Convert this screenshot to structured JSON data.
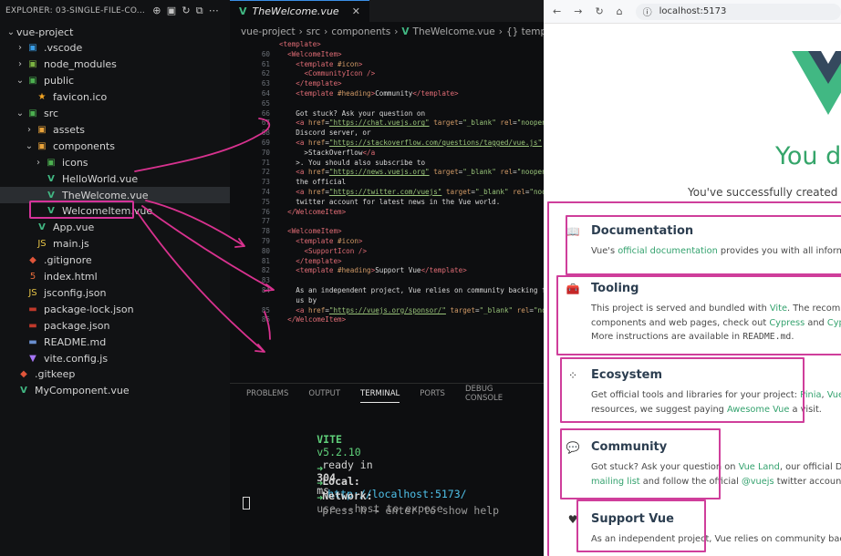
{
  "explorer": {
    "header": "EXPLORER: 03-SINGLE-FILE-CO...",
    "tree": [
      {
        "label": "vue-project",
        "depth": 0,
        "chev": "⌄",
        "icon": "",
        "icolor": "#ccc"
      },
      {
        "label": ".vscode",
        "depth": 1,
        "chev": "›",
        "icon": "▣",
        "icolor": "#3a9ee8"
      },
      {
        "label": "node_modules",
        "depth": 1,
        "chev": "›",
        "icon": "▣",
        "icolor": "#7cb342"
      },
      {
        "label": "public",
        "depth": 1,
        "chev": "⌄",
        "icon": "▣",
        "icolor": "#4caf50"
      },
      {
        "label": "favicon.ico",
        "depth": 2,
        "chev": "",
        "icon": "★",
        "icolor": "#f5a623"
      },
      {
        "label": "src",
        "depth": 1,
        "chev": "⌄",
        "icon": "▣",
        "icolor": "#4caf50"
      },
      {
        "label": "assets",
        "depth": 2,
        "chev": "›",
        "icon": "▣",
        "icolor": "#e8a23a"
      },
      {
        "label": "components",
        "depth": 2,
        "chev": "⌄",
        "icon": "▣",
        "icolor": "#e8a23a"
      },
      {
        "label": "icons",
        "depth": 3,
        "chev": "›",
        "icon": "▣",
        "icolor": "#4caf50"
      },
      {
        "label": "HelloWorld.vue",
        "depth": 3,
        "chev": "",
        "icon": "V",
        "icolor": "#41b883"
      },
      {
        "label": "TheWelcome.vue",
        "depth": 3,
        "chev": "",
        "icon": "V",
        "icolor": "#41b883"
      },
      {
        "label": "WelcomeItem.vue",
        "depth": 3,
        "chev": "",
        "icon": "V",
        "icolor": "#41b883"
      },
      {
        "label": "App.vue",
        "depth": 2,
        "chev": "",
        "icon": "V",
        "icolor": "#41b883"
      },
      {
        "label": "main.js",
        "depth": 2,
        "chev": "",
        "icon": "JS",
        "icolor": "#e8c547"
      },
      {
        "label": ".gitignore",
        "depth": 1,
        "chev": "",
        "icon": "◆",
        "icolor": "#e0553a"
      },
      {
        "label": "index.html",
        "depth": 1,
        "chev": "",
        "icon": "5",
        "icolor": "#e86b3a"
      },
      {
        "label": "jsconfig.json",
        "depth": 1,
        "chev": "",
        "icon": "JS",
        "icolor": "#e8c547"
      },
      {
        "label": "package-lock.json",
        "depth": 1,
        "chev": "",
        "icon": "▬",
        "icolor": "#c0392b"
      },
      {
        "label": "package.json",
        "depth": 1,
        "chev": "",
        "icon": "▬",
        "icolor": "#c0392b"
      },
      {
        "label": "README.md",
        "depth": 1,
        "chev": "",
        "icon": "▬",
        "icolor": "#6a8fcf"
      },
      {
        "label": "vite.config.js",
        "depth": 1,
        "chev": "",
        "icon": "▼",
        "icolor": "#a675f5"
      },
      {
        "label": ".gitkeep",
        "depth": 0,
        "chev": "",
        "icon": "◆",
        "icolor": "#e0553a"
      },
      {
        "label": "MyComponent.vue",
        "depth": 0,
        "chev": "",
        "icon": "V",
        "icolor": "#41b883"
      }
    ]
  },
  "editor": {
    "tab_label": "TheWelcome.vue",
    "breadcrumb": [
      "vue-project",
      "src",
      "components",
      "TheWelcome.vue",
      "{} template"
    ],
    "code_lines": [
      {
        "n": "",
        "html": "<span class=\"tg\">&lt;template&gt;</span>"
      },
      {
        "n": "60",
        "html": "  <span class=\"tg\">&lt;WelcomeItem&gt;</span>"
      },
      {
        "n": "61",
        "html": "    <span class=\"tg\">&lt;template</span> <span class=\"at\">#icon</span><span class=\"tg\">&gt;</span>"
      },
      {
        "n": "62",
        "html": "      <span class=\"tg\">&lt;CommunityIcon /&gt;</span>"
      },
      {
        "n": "63",
        "html": "    <span class=\"tg\">&lt;/template&gt;</span>"
      },
      {
        "n": "64",
        "html": "    <span class=\"tg\">&lt;template</span> <span class=\"at\">#heading</span><span class=\"tg\">&gt;</span>Community<span class=\"tg\">&lt;/template&gt;</span>"
      },
      {
        "n": "65",
        "html": ""
      },
      {
        "n": "66",
        "html": "    Got stuck? Ask your question on"
      },
      {
        "n": "67",
        "html": "    <span class=\"tg\">&lt;a</span> <span class=\"at\">href</span>=<span class=\"lk\">\"https://chat.vuejs.org\"</span> <span class=\"at\">target</span>=<span class=\"st\">\"_blank\"</span> <span class=\"at\">rel</span>=<span class=\"st\">\"noopene</span>"
      },
      {
        "n": "68",
        "html": "    Discord server, or"
      },
      {
        "n": "69",
        "html": "    <span class=\"tg\">&lt;a</span> <span class=\"at\">href</span>=<span class=\"lk\">\"https://stackoverflow.com/questions/tagged/vue.js\"</span> <span class=\"at\">t</span>"
      },
      {
        "n": "70",
        "html": "      &gt;StackOverflow<span class=\"tg\">&lt;/a</span>"
      },
      {
        "n": "71",
        "html": "    &gt;. You should also subscribe to"
      },
      {
        "n": "72",
        "html": "    <span class=\"tg\">&lt;a</span> <span class=\"at\">href</span>=<span class=\"lk\">\"https://news.vuejs.org\"</span> <span class=\"at\">target</span>=<span class=\"st\">\"_blank\"</span> <span class=\"at\">rel</span>=<span class=\"st\">\"noopene</span>"
      },
      {
        "n": "73",
        "html": "    the official"
      },
      {
        "n": "74",
        "html": "    <span class=\"tg\">&lt;a</span> <span class=\"at\">href</span>=<span class=\"lk\">\"https://twitter.com/vuejs\"</span> <span class=\"at\">target</span>=<span class=\"st\">\"_blank\"</span> <span class=\"at\">rel</span>=<span class=\"st\">\"noop</span>"
      },
      {
        "n": "75",
        "html": "    twitter account for latest news in the Vue world."
      },
      {
        "n": "76",
        "html": "  <span class=\"tg\">&lt;/WelcomeItem&gt;</span>"
      },
      {
        "n": "77",
        "html": ""
      },
      {
        "n": "78",
        "html": "  <span class=\"tg\">&lt;WelcomeItem&gt;</span>"
      },
      {
        "n": "79",
        "html": "    <span class=\"tg\">&lt;template</span> <span class=\"at\">#icon</span><span class=\"tg\">&gt;</span>"
      },
      {
        "n": "80",
        "html": "      <span class=\"tg\">&lt;SupportIcon /&gt;</span>"
      },
      {
        "n": "81",
        "html": "    <span class=\"tg\">&lt;/template&gt;</span>"
      },
      {
        "n": "82",
        "html": "    <span class=\"tg\">&lt;template</span> <span class=\"at\">#heading</span><span class=\"tg\">&gt;</span>Support Vue<span class=\"tg\">&lt;/template&gt;</span>"
      },
      {
        "n": "83",
        "html": ""
      },
      {
        "n": "84",
        "html": "    As an independent project, Vue relies on community backing fo"
      },
      {
        "n": "",
        "html": "    us by"
      },
      {
        "n": "85",
        "html": "    <span class=\"tg\">&lt;a</span> <span class=\"at\">href</span>=<span class=\"lk\">\"https://vuejs.org/sponsor/\"</span> <span class=\"at\">target</span>=<span class=\"st\">\"_blank\"</span> <span class=\"at\">rel</span>=<span class=\"st\">\"noo</span>"
      },
      {
        "n": "86",
        "html": "  <span class=\"tg\">&lt;/WelcomeItem&gt;</span>"
      }
    ],
    "panel_tabs": [
      "PROBLEMS",
      "OUTPUT",
      "TERMINAL",
      "PORTS",
      "DEBUG CONSOLE"
    ],
    "panel_active": "TERMINAL",
    "terminal": {
      "vite": "VITE",
      "version": "v5.2.10",
      "ready": "ready in",
      "ms": "304",
      "ms_unit": "ms",
      "local_label": "Local:",
      "local_url": "http://localhost:5173/",
      "network_label": "Network:",
      "network_text": "use --host to expose",
      "help_text": "press h + enter to show help",
      "arrow": "➜"
    }
  },
  "browser": {
    "url": "localhost:5173",
    "hero_title": "You d",
    "hero_sub": "You've successfully created a",
    "items": [
      {
        "icon": "📖",
        "heading": "Documentation",
        "lines": [
          [
            "Vue's ",
            [
              "official documentation"
            ],
            " provides you with all informati"
          ]
        ]
      },
      {
        "icon": "🧰",
        "heading": "Tooling",
        "lines": [
          [
            "This project is served and bundled with ",
            [
              "Vite"
            ],
            ". The recommen"
          ],
          [
            "components and web pages, check out ",
            [
              "Cypress"
            ],
            " and ",
            [
              "Cypress"
            ]
          ],
          [
            "More instructions are available in ",
            {
              "mono": "README.md"
            },
            "."
          ]
        ]
      },
      {
        "icon": "⁘",
        "heading": "Ecosystem",
        "lines": [
          [
            "Get official tools and libraries for your project: ",
            [
              "Pinia"
            ],
            ", ",
            [
              "Vue Ro"
            ]
          ],
          [
            "resources, we suggest paying ",
            [
              "Awesome Vue"
            ],
            " a visit."
          ]
        ]
      },
      {
        "icon": "💬",
        "heading": "Community",
        "lines": [
          [
            "Got stuck? Ask your question on ",
            [
              "Vue Land"
            ],
            ", our official Disco"
          ],
          [
            [
              "mailing list"
            ],
            " and follow the official ",
            [
              "@vuejs"
            ],
            " twitter account fo"
          ]
        ]
      },
      {
        "icon": "♥",
        "heading": "Support Vue",
        "lines": [
          [
            "As an independent project, Vue relies on community backing"
          ]
        ]
      }
    ]
  },
  "colors": {
    "accent": "#d6339a",
    "vue_green": "#41b883",
    "terminal_green": "#5fd07a"
  }
}
